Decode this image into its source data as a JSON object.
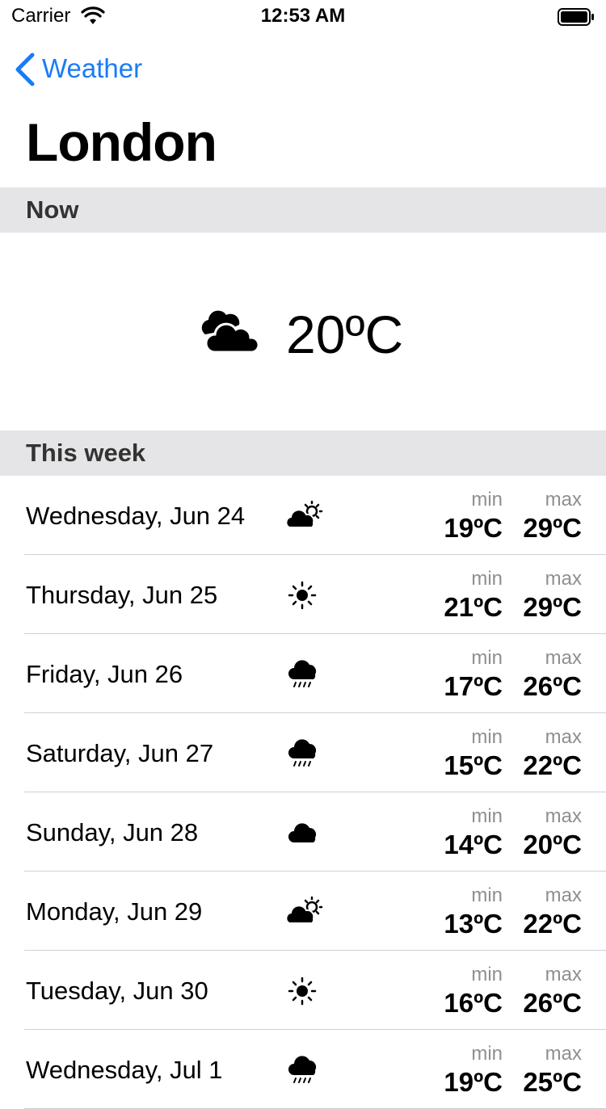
{
  "status_bar": {
    "carrier": "Carrier",
    "time": "12:53 AM"
  },
  "nav": {
    "back_label": "Weather"
  },
  "title": "London",
  "now": {
    "section_label": "Now",
    "condition_icon": "cloudy-icon",
    "temperature": "20ºC"
  },
  "week": {
    "section_label": "This week",
    "min_label": "min",
    "max_label": "max",
    "days": [
      {
        "day": "Wednesday, Jun 24",
        "icon": "partly-sunny-icon",
        "min": "19ºC",
        "max": "29ºC"
      },
      {
        "day": "Thursday, Jun 25",
        "icon": "sun-icon",
        "min": "21ºC",
        "max": "29ºC"
      },
      {
        "day": "Friday, Jun 26",
        "icon": "rain-icon",
        "min": "17ºC",
        "max": "26ºC"
      },
      {
        "day": "Saturday, Jun 27",
        "icon": "rain-icon",
        "min": "15ºC",
        "max": "22ºC"
      },
      {
        "day": "Sunday, Jun 28",
        "icon": "cloud-icon",
        "min": "14ºC",
        "max": "20ºC"
      },
      {
        "day": "Monday, Jun 29",
        "icon": "partly-sunny-icon",
        "min": "13ºC",
        "max": "22ºC"
      },
      {
        "day": "Tuesday, Jun 30",
        "icon": "sun-icon",
        "min": "16ºC",
        "max": "26ºC"
      },
      {
        "day": "Wednesday, Jul 1",
        "icon": "rain-icon",
        "min": "19ºC",
        "max": "25ºC"
      }
    ]
  },
  "colors": {
    "accent": "#1a7cf5",
    "section_bg": "#e5e5e7",
    "secondary_text": "#8e8e93"
  }
}
